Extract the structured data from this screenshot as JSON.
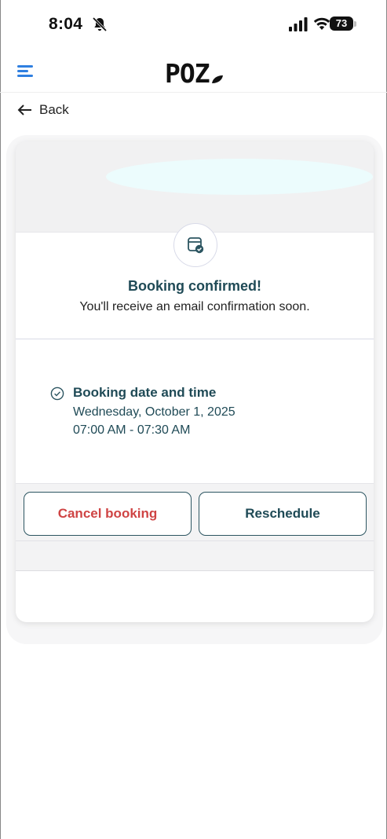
{
  "status_bar": {
    "time": "8:04",
    "battery": "73"
  },
  "header": {
    "logo_text": "POZ"
  },
  "nav": {
    "back_label": "Back"
  },
  "confirmation": {
    "title": "Booking confirmed!",
    "subtitle": "You'll receive an email confirmation soon."
  },
  "details": {
    "label": "Booking date and time",
    "date": "Wednesday, October 1, 2025",
    "time_range": "07:00 AM - 07:30 AM"
  },
  "actions": {
    "cancel_label": "Cancel booking",
    "reschedule_label": "Reschedule"
  },
  "colors": {
    "primary_text": "#1f4a56",
    "cancel_red": "#cf4444",
    "menu_blue": "#2f7fe0"
  }
}
